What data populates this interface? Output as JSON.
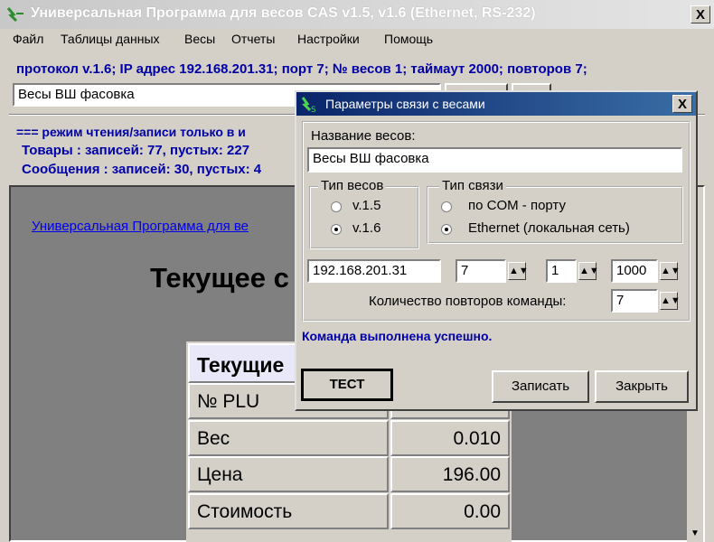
{
  "window": {
    "title": "Универсальная Программа для весов CAS v1.5, v1.6 (Ethernet, RS-232)",
    "close_label": "X"
  },
  "menu": [
    "Файл",
    "Таблицы данных",
    "Весы",
    "Отчеты",
    "Настройки",
    "Помощь"
  ],
  "protocol_line": "протокол v.1.6; IP адрес 192.168.201.31; порт 7; № весов 1; таймаут 2000; повторов 7;",
  "scale_select": {
    "value": "Весы ВШ фасовка"
  },
  "toolbar_buttons": {
    "test_short": "ТЕСТ",
    "extra": "..."
  },
  "status": {
    "mode_line": "=== режим чтения/записи только в и",
    "goods_line": "Товары : записей: 77, пустых: 227",
    "messages_line": "Сообщения : записей: 30, пустых: 4"
  },
  "content": {
    "link": "Универсальная Программа для ве",
    "heading": "Текущее с",
    "table_header": "Текущие",
    "rows": [
      {
        "label": "№ PLU",
        "value": ""
      },
      {
        "label": "Вес",
        "value": "0.010"
      },
      {
        "label": "Цена",
        "value": "196.00"
      },
      {
        "label": "Стоимость",
        "value": "0.00"
      }
    ]
  },
  "dialog": {
    "title": "Параметры связи с весами",
    "close_label": "X",
    "name_label": "Название весов:",
    "name_value": "Весы ВШ фасовка",
    "scale_type": {
      "legend": "Тип весов",
      "options": [
        {
          "label": "v.1.5",
          "selected": false
        },
        {
          "label": "v.1.6",
          "selected": true
        }
      ]
    },
    "link_type": {
      "legend": "Тип связи",
      "options": [
        {
          "label": "по COM - порту",
          "selected": false
        },
        {
          "label": "Ethernet (локальная сеть)",
          "selected": true
        }
      ]
    },
    "ip": "192.168.201.31",
    "port": "7",
    "scale_number": "1",
    "timeout": "1000",
    "retries_label": "Количество повторов команды:",
    "retries": "7",
    "message": "Команда выполнена успешно.",
    "buttons": {
      "test": "ТЕСТ",
      "write": "Записать",
      "close": "Закрыть"
    }
  },
  "colors": {
    "info_text": "#0000a8",
    "dialog_title": "#0a246a",
    "content_bg": "#808080"
  }
}
